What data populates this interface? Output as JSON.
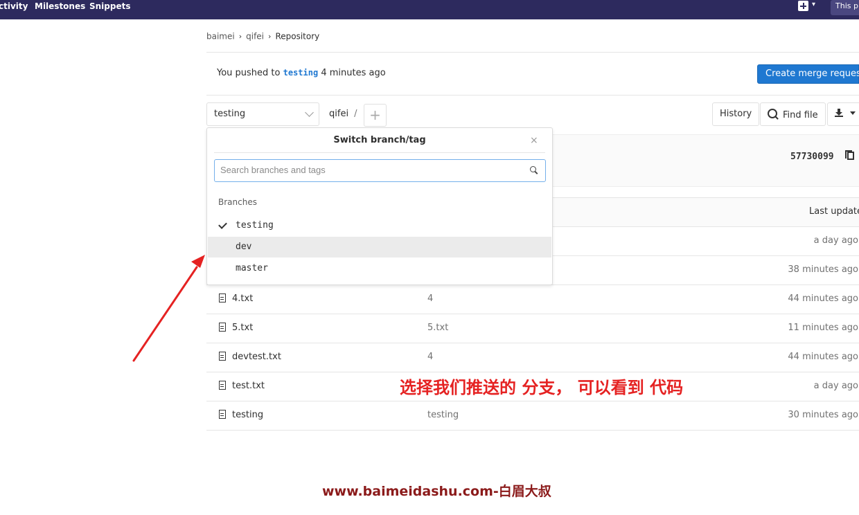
{
  "topnav": {
    "items": [
      "ctivity",
      "Milestones",
      "Snippets"
    ],
    "project_label": "This pr"
  },
  "breadcrumb": [
    "baimei",
    "qifei",
    "Repository"
  ],
  "push_notice": {
    "prefix": "You pushed to",
    "branch": "testing",
    "suffix": "4 minutes ago",
    "button": "Create merge request"
  },
  "toolbar": {
    "branch": "testing",
    "path": "qifei",
    "path_sep": "/",
    "add_symbol": "+",
    "history": "History",
    "find_file": "Find file"
  },
  "commit": {
    "sha": "57730099"
  },
  "table": {
    "last_update_header": "Last update",
    "rows": [
      {
        "name": "",
        "message": "",
        "time": "a day ago"
      },
      {
        "name": "",
        "message": "",
        "time": "38 minutes ago"
      },
      {
        "name": "4.txt",
        "message": "4",
        "time": "44 minutes ago"
      },
      {
        "name": "5.txt",
        "message": "5.txt",
        "time": "11 minutes ago"
      },
      {
        "name": "devtest.txt",
        "message": "4",
        "time": "44 minutes ago"
      },
      {
        "name": "test.txt",
        "message": "",
        "time": "a day ago"
      },
      {
        "name": "testing",
        "message": "testing",
        "time": "30 minutes ago"
      }
    ]
  },
  "dropdown": {
    "title": "Switch branch/tag",
    "close": "×",
    "search_placeholder": "Search branches and tags",
    "section": "Branches",
    "branches": [
      "testing",
      "dev",
      "master"
    ],
    "selected": "testing",
    "highlighted": "dev"
  },
  "annotation": "选择我们推送的 分支， 可以看到 代码",
  "watermark": "www.baimeidashu.com-白眉大叔",
  "colors": {
    "nav_bg": "#2d2a5e",
    "primary": "#1f78d1",
    "annotation": "#e52222",
    "watermark": "#8b1a1a"
  }
}
